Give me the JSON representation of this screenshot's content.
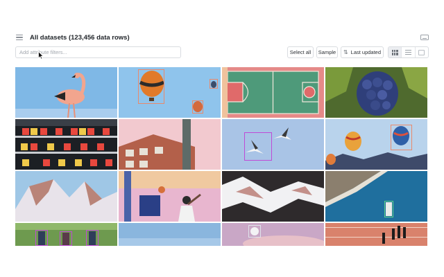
{
  "header": {
    "title": "All datasets (123,456 data rows)",
    "menu_icon": "hamburger-icon",
    "right_icon": "keyboard-icon"
  },
  "toolbar": {
    "filter_placeholder": "Add attribute filters...",
    "select_all_label": "Select all",
    "sample_label": "Sample",
    "sort_label": "Last updated",
    "sort_icon": "sort-icon",
    "views": [
      "grid-view-icon",
      "list-view-icon",
      "column-view-icon"
    ],
    "active_view": "grid-view-icon"
  },
  "gallery": {
    "columns": 4,
    "tiles": [
      "flamingo",
      "hot-air-balloons-sky",
      "basketball-court-aerial",
      "grapes-vine",
      "supermarket-shelves",
      "brick-building-chimney",
      "seagulls-sky",
      "hot-air-balloons-mountains",
      "snowy-mountains",
      "basketball-player-pink-sky",
      "snowy-mountain-aerial",
      "coast-aerial-boat",
      "people-in-park",
      "blue-sky-clouds",
      "clouds-moon",
      "people-walking-aerial"
    ],
    "annotation_colors": {
      "orange": "#e9896b",
      "purple": "#c04ad6",
      "green": "#5fd48a"
    }
  },
  "colors": {
    "accent": "#1f2328",
    "border": "#d9dce0",
    "background": "#ffffff"
  }
}
